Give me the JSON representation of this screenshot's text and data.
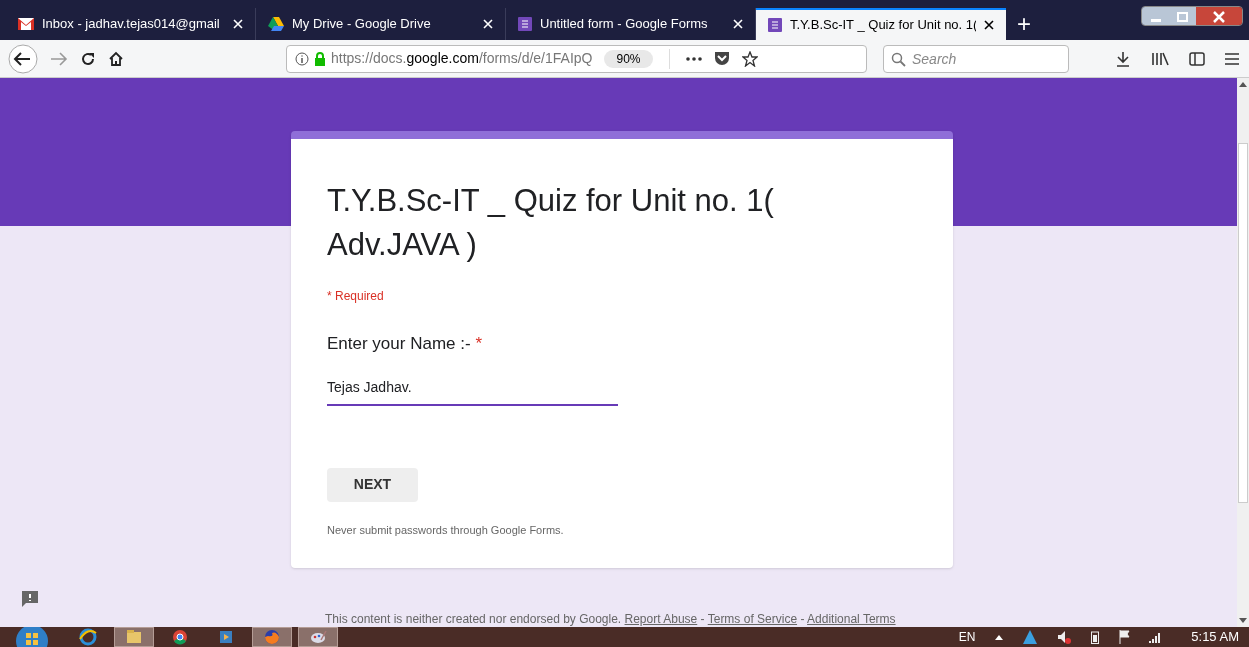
{
  "browser": {
    "tabs": [
      {
        "title": "Inbox - jadhav.tejas014@gmail",
        "kind": "mail",
        "selected": false
      },
      {
        "title": "My Drive - Google Drive",
        "kind": "drive",
        "selected": false
      },
      {
        "title": "Untitled form - Google Forms",
        "kind": "forms",
        "selected": false
      },
      {
        "title": "T.Y.B.Sc-IT _ Quiz for Unit no. 1(",
        "kind": "forms",
        "selected": true
      }
    ],
    "new_tab": "+",
    "url": {
      "prefix": "https://docs.",
      "domain": "google.com",
      "path": "/forms/d/e/1FAIpQ"
    },
    "zoom": "90%",
    "search_placeholder": "Search"
  },
  "form": {
    "title": "T.Y.B.Sc-IT _ Quiz for Unit no. 1( Adv.JAVA )",
    "required_note": "* Required",
    "question": {
      "label": "Enter your Name :-",
      "required": true,
      "required_mark": "*",
      "value": "Tejas Jadhav."
    },
    "next_button": "NEXT",
    "notice": "Never submit passwords through Google Forms."
  },
  "footer": {
    "text": "This content is neither created nor endorsed by Google.",
    "links": [
      "Report Abuse",
      "Terms of Service",
      "Additional Terms"
    ],
    "separator": "-"
  },
  "taskbar": {
    "apps": [
      {
        "kind": "ie",
        "active": false
      },
      {
        "kind": "explorer",
        "active": true
      },
      {
        "kind": "chrome",
        "active": false
      },
      {
        "kind": "media",
        "active": false
      },
      {
        "kind": "firefox",
        "active": true
      },
      {
        "kind": "paint",
        "active": true
      }
    ],
    "language": "EN",
    "time": "5:15 AM"
  }
}
